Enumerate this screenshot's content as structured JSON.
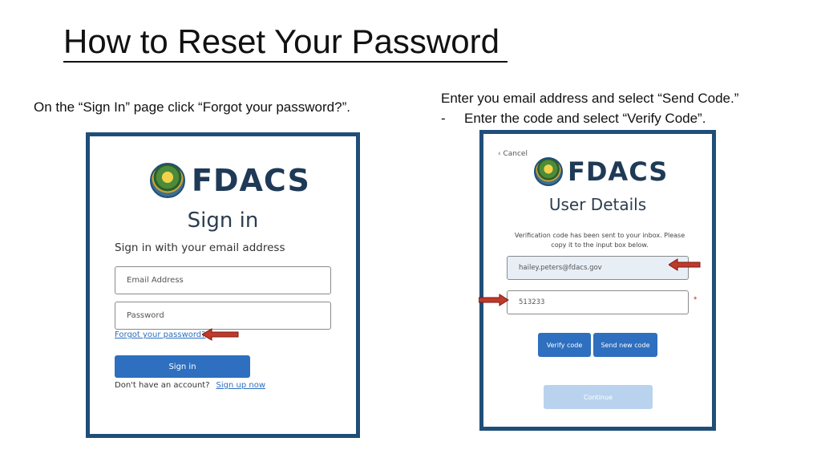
{
  "slide": {
    "title": "How to Reset Your Password",
    "left_caption": "On the “Sign In” page click “Forgot your password?”.",
    "right_caption_line1": "Enter you email address and select “Send Code.”",
    "right_caption_dash": "-",
    "right_caption_line2": "Enter the code and select “Verify Code”."
  },
  "signin_screen": {
    "logo_text": "FDACS",
    "heading": "Sign in",
    "subheading": "Sign in with your email address",
    "email_placeholder": "Email Address",
    "password_placeholder": "Password",
    "forgot_link": "Forgot your password?",
    "signin_button": "Sign in",
    "no_account_text": "Don't have an account?",
    "signup_link": "Sign up now"
  },
  "verify_screen": {
    "cancel_label": "Cancel",
    "logo_text": "FDACS",
    "heading": "User Details",
    "message": "Verification code has been sent to your inbox. Please copy it to the input box below.",
    "email_value": "hailey.peters@fdacs.gov",
    "code_value": "513233",
    "required_marker": "*",
    "verify_button": "Verify code",
    "send_new_button": "Send new code",
    "continue_button": "Continue"
  },
  "colors": {
    "panel_border": "#1f4e79",
    "primary_button": "#2e6fbf",
    "arrow": "#c0392b"
  }
}
